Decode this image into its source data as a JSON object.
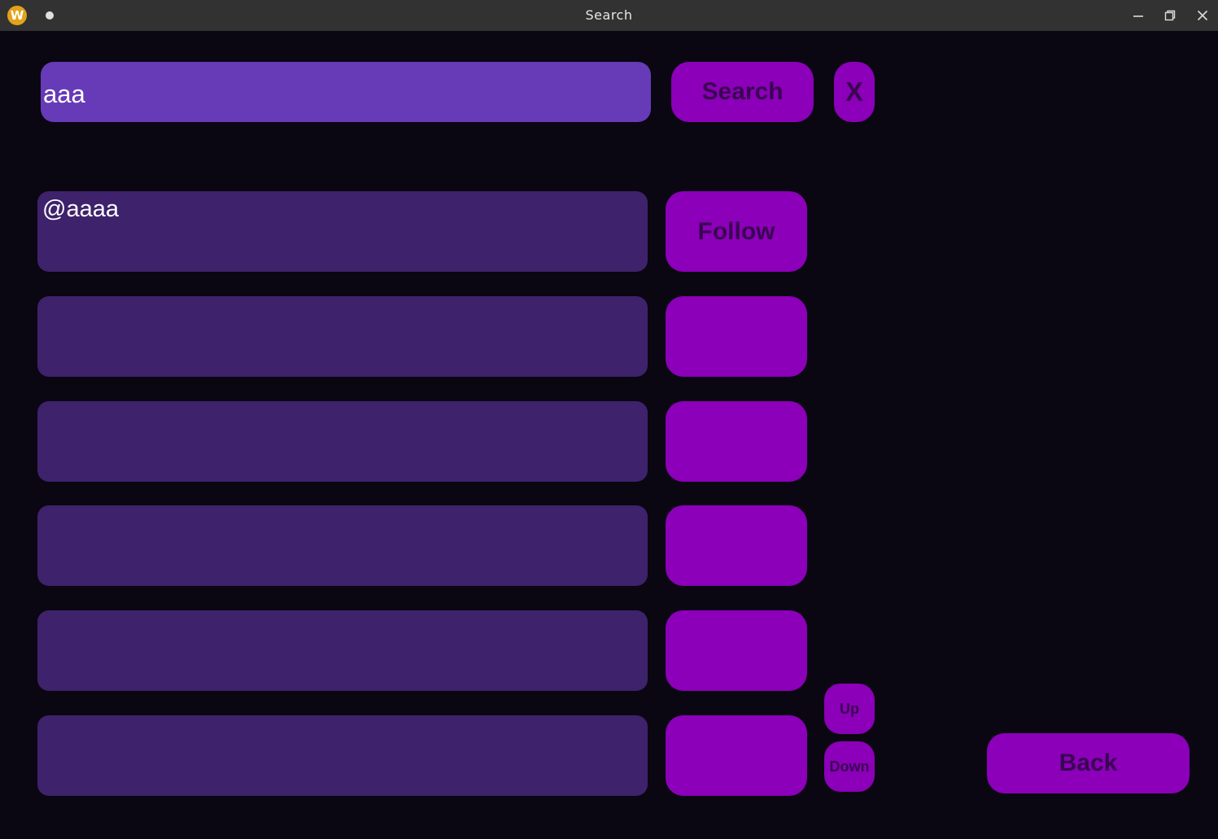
{
  "window": {
    "title": "Search",
    "app_icon_letter": "W",
    "app_icon_color": "#e3a21a"
  },
  "search": {
    "value": "aaa",
    "button_label": "Search",
    "clear_label": "X"
  },
  "results": [
    {
      "handle": "@aaaa",
      "action_label": "Follow"
    },
    {
      "handle": "",
      "action_label": ""
    },
    {
      "handle": "",
      "action_label": ""
    },
    {
      "handle": "",
      "action_label": ""
    },
    {
      "handle": "",
      "action_label": ""
    },
    {
      "handle": "",
      "action_label": ""
    }
  ],
  "pager": {
    "up_label": "Up",
    "down_label": "Down"
  },
  "back_label": "Back",
  "colors": {
    "background": "#0a0612",
    "input": "#673ab7",
    "row": "#3e226b",
    "button": "#8b00b8",
    "button_text": "#3a0552"
  }
}
